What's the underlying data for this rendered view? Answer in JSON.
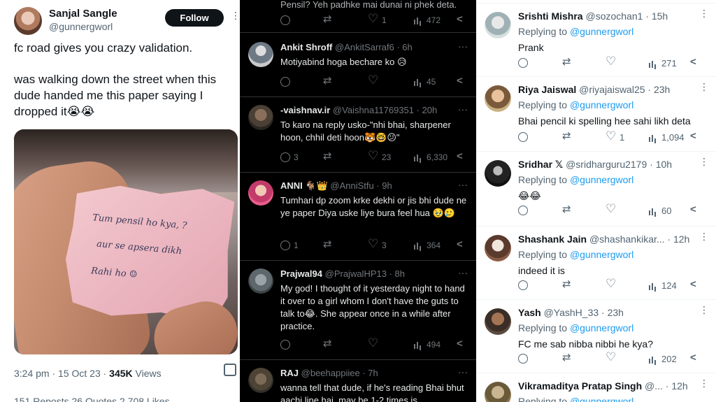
{
  "left": {
    "author_name": "Sanjal Sangle",
    "author_handle": "@gunnergworl",
    "follow_label": "Follow",
    "more_label": "⋮",
    "text_line1": "fc road gives you crazy validation.",
    "text_line2": "was walking down the street when this dude handed me this paper saying I dropped it😭😭",
    "note_lines": [
      "Tum pensil ho kya, ?",
      "aur se apsera dikh",
      "Rahi ho  ☺"
    ],
    "meta_time": "3:24 pm · 15 Oct 23 · ",
    "meta_views_count": "345K",
    "meta_views_label": " Views",
    "stats_text": "151 Reposts  26 Quotes  2,708 Likes"
  },
  "middle": {
    "top_partial": {
      "text": "Pensil? Yeh padhke mai dunai ni phek deta.",
      "actions": {
        "reply": "",
        "retweet": "",
        "like": "1",
        "views": "472"
      }
    },
    "replies": [
      {
        "name": "Ankit Shroff",
        "handle": "@AnkitSarraf6 · 6h",
        "text": "Motiyabind hoga bechare ko 😥",
        "actions": {
          "reply": "",
          "retweet": "",
          "like": "",
          "views": "45"
        }
      },
      {
        "name": "-vaishnav.ir",
        "handle": "@Vaishna11769351 · 20h",
        "text": "To karo na reply usko-\"nhi bhai, sharpener hoon, chhil deti hoon🐯🤓😕\"",
        "actions": {
          "reply": "3",
          "retweet": "",
          "like": "23",
          "views": "6,330"
        }
      },
      {
        "name": "ANNI 🐐👑",
        "handle": "@AnniStfu · 9h",
        "text": "Tumhari dp zoom krke dekhi or jis bhi dude ne ye paper Diya uske liye bura feel hua 🥹🥲",
        "actions": {
          "reply": "1",
          "retweet": "",
          "like": "3",
          "views": "364"
        }
      },
      {
        "name": "Prajwal94",
        "handle": "@PrajwalHP13 · 8h",
        "text": "My god! I thought of it yesterday night to hand it over to a girl whom I don't have the guts to talk to😂. She appear once in a while after practice.",
        "actions": {
          "reply": "",
          "retweet": "",
          "like": "",
          "views": "494"
        }
      },
      {
        "name": "RAJ",
        "handle": "@beehappiiee · 7h",
        "text": "wanna tell that dude, if he's reading Bhai bhut aachi line hai, may be 1-2 times is",
        "actions": {
          "reply": "",
          "retweet": "",
          "like": "",
          "views": ""
        }
      }
    ],
    "more_label": "···"
  },
  "right": {
    "replying_prefix": "Replying to ",
    "replying_to": "@gunnergworl",
    "more_label": "⋮",
    "replies": [
      {
        "name": "Srishti Mishra",
        "handle": "@sozochan1 · 15h",
        "text": "Prank",
        "actions": {
          "reply": "",
          "retweet": "",
          "like": "",
          "views": "271"
        }
      },
      {
        "name": "Riya Jaiswal",
        "handle": "@riyajaiswal25 · 23h",
        "text": "Bhai pencil ki spelling hee sahi likh deta",
        "actions": {
          "reply": "",
          "retweet": "",
          "like": "1",
          "views": "1,094"
        }
      },
      {
        "name": "Sridhar 𝕏",
        "handle": "@sridharguru2179 · 10h",
        "text": "😂😂",
        "actions": {
          "reply": "",
          "retweet": "",
          "like": "",
          "views": "60"
        }
      },
      {
        "name": "Shashank Jain",
        "handle": "@shashankikar... · 12h",
        "text": "indeed it is",
        "actions": {
          "reply": "",
          "retweet": "",
          "like": "",
          "views": "124"
        }
      },
      {
        "name": "Yash",
        "handle": "@YashH_33 · 23h",
        "text": "FC me sab nibba nibbi he kya?",
        "actions": {
          "reply": "",
          "retweet": "",
          "like": "",
          "views": "202"
        }
      },
      {
        "name": "Vikramaditya Pratap Singh",
        "handle": "@... · 12h",
        "text": "",
        "actions": {
          "reply": "",
          "retweet": "",
          "like": "",
          "views": ""
        }
      }
    ]
  },
  "colors": {
    "link": "#1d9bf0",
    "dark_bg": "#000000",
    "muted": "#536471",
    "muted_dark": "#71767b"
  }
}
